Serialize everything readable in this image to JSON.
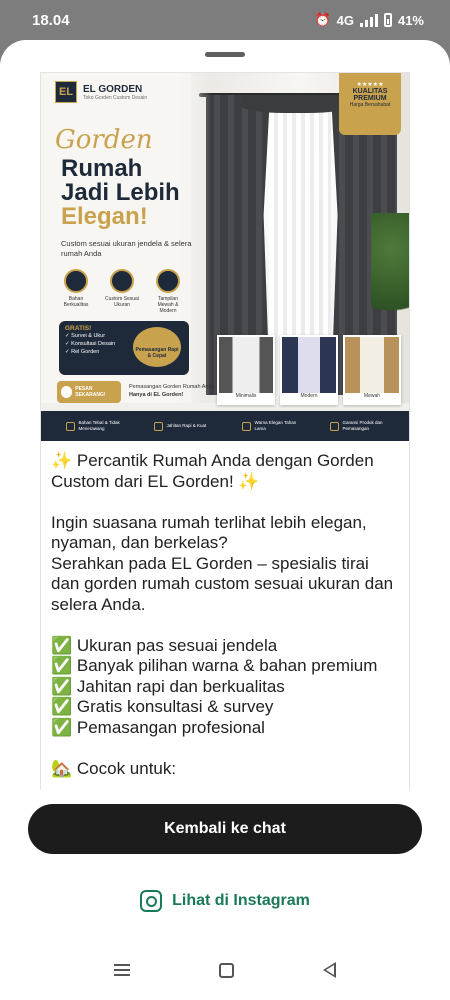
{
  "status_bar": {
    "time": "18.04",
    "network": "4G",
    "battery": "41%"
  },
  "banner": {
    "brand": "EL GORDEN",
    "brand_tagline": "Toko Gorden Custom Desain",
    "script_word": "Gorden",
    "headline_1": "Rumah",
    "headline_2": "Jadi Lebih",
    "headline_3": "Elegan!",
    "subtext": "Custom sesuai ukuran jendela & selera rumah Anda",
    "features": [
      {
        "label": "Bahan Berkualitas"
      },
      {
        "label": "Custom Sesuai Ukuran"
      },
      {
        "label": "Tampilan Mewah & Modern"
      }
    ],
    "gratis_title": "GRATIS!",
    "gratis_items": [
      "Survei & Ukur",
      "Konsultasi Desain",
      "Rel Gorden"
    ],
    "install_badge": "Pemasangan Rapi & Cepat",
    "quality_stars": "★★★★★",
    "quality_title": "KUALITAS PREMIUM",
    "quality_sub": "Harga Bersahabat",
    "thumbs": [
      "Minimalis",
      "Modern",
      "Mewah"
    ],
    "cta_label": "PESAN SEKARANG!",
    "cta_text_1": "Pemasangan Gorden Rumah Anda",
    "cta_text_2": "Hanya di EL Gorden!",
    "footer_items": [
      "Bahan Tebal & Tidak Menerawang",
      "Jahitan Rapi & Kuat",
      "Warna Elegan Tahan Lama",
      "Garansi Produk dan Pemasangan"
    ]
  },
  "caption": {
    "lines": [
      "✨ Percantik Rumah Anda dengan Gorden Custom dari EL Gorden! ✨",
      "",
      "Ingin suasana rumah terlihat lebih elegan, nyaman, dan berkelas?",
      "Serahkan pada EL Gorden – spesialis tirai dan gorden rumah custom sesuai ukuran dan selera Anda.",
      "",
      "✅ Ukuran pas sesuai jendela",
      "✅ Banyak pilihan warna & bahan premium",
      "✅ Jahitan rapi dan berkualitas",
      "✅ Gratis konsultasi & survey",
      "✅ Pemasangan profesional",
      "",
      "🏡 Cocok untuk:"
    ]
  },
  "actions": {
    "back_to_chat": "Kembali ke chat",
    "view_instagram": "Lihat di Instagram"
  },
  "colors": {
    "navy": "#1e2a3a",
    "gold": "#c9a24e",
    "instagram_link": "#1a7a58",
    "primary_button": "#1c1c1c"
  }
}
